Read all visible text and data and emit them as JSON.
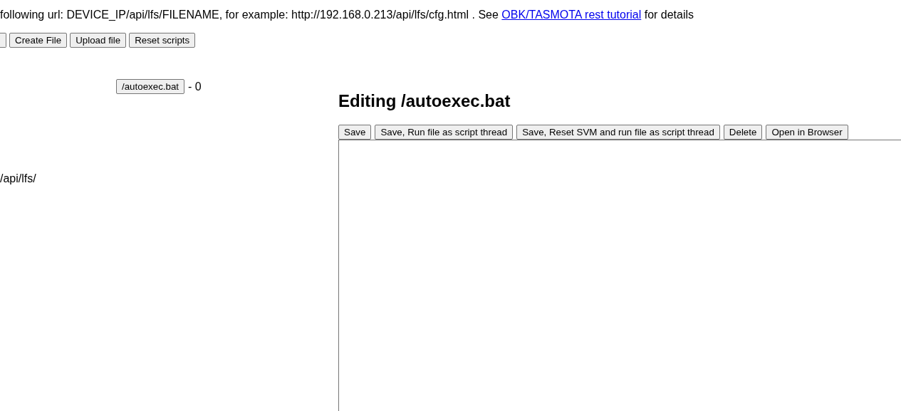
{
  "intro": {
    "text": "following url: DEVICE_IP/api/lfs/FILENAME, for example: http://192.168.0.213/api/lfs/cfg.html . See ",
    "link": "OBK/TASMOTA rest tutorial",
    "after": " for details"
  },
  "toolbar": [
    "Create File",
    "Upload file",
    "Reset scripts"
  ],
  "files": [
    {
      "name": "/autoexec.bat",
      "size": "- 0"
    }
  ],
  "path": "/api/lfs/",
  "editor": {
    "title": "Editing /autoexec.bat",
    "buttons": [
      "Save",
      "Save, Run file as script thread",
      "Save, Reset SVM and run file as script thread",
      "Delete",
      "Open in Browser"
    ]
  }
}
